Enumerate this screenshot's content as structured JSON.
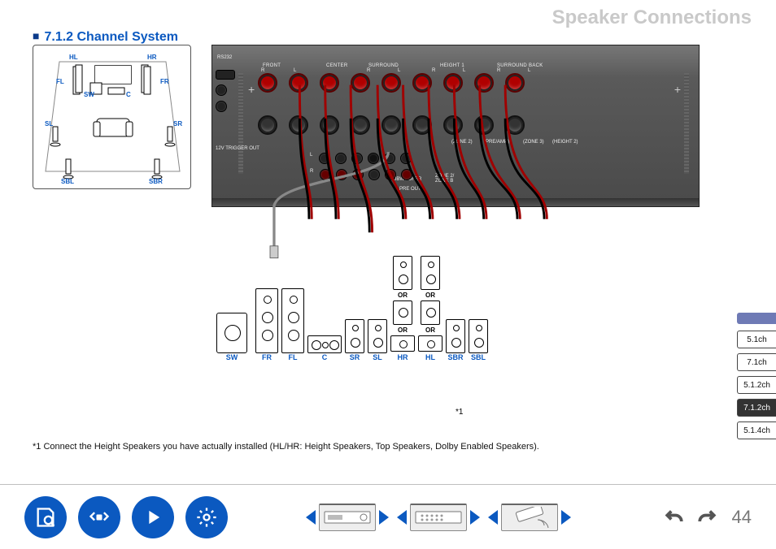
{
  "header": {
    "title": "Speaker Connections"
  },
  "section": {
    "title": "7.1.2 Channel System"
  },
  "room_labels": {
    "hl": "HL",
    "hr": "HR",
    "fl": "FL",
    "fr": "FR",
    "sw": "SW",
    "c": "C",
    "sl": "SL",
    "sr": "SR",
    "sbl": "SBL",
    "sbr": "SBR"
  },
  "panel_groups": [
    "FRONT",
    "CENTER",
    "SURROUND",
    "HEIGHT 1",
    "SURROUND BACK"
  ],
  "panel_rl": {
    "r": "R",
    "l": "L"
  },
  "panel_small_labels": {
    "rs232": "RS232",
    "trigger": "12V TRIGGER OUT",
    "preout": "PRE OUT",
    "subwoofer": "SUBWOOFER",
    "zone2_lineout": "(ZONE 2)",
    "zone3": "(ZONE 3)",
    "preamp": "(PRE/AMP)",
    "height2": "(HEIGHT 2)",
    "zone2_zoneB": "ZONE 2/\nZONE B"
  },
  "speaker_labels": [
    "SW",
    "FR",
    "FL",
    "C",
    "SR",
    "SL",
    "SBR",
    "SBL",
    "HR",
    "HL"
  ],
  "alt_labels": {
    "or": "OR"
  },
  "height_alt": {
    "hr": "HR",
    "hl": "HL"
  },
  "footnote_marker": "*1",
  "footnote_text": "*1 Connect the Height Speakers you have actually installed (HL/HR: Height Speakers, Top Speakers, Dolby Enabled Speakers).",
  "channel_tabs": [
    {
      "label": "5.1ch",
      "active": false
    },
    {
      "label": "7.1ch",
      "active": false
    },
    {
      "label": "5.1.2ch",
      "active": false
    },
    {
      "label": "7.1.2ch",
      "active": true
    },
    {
      "label": "5.1.4ch",
      "active": false
    }
  ],
  "nav_icons": [
    "manual-icon",
    "connections-icon",
    "play-icon",
    "settings-icon"
  ],
  "page_number": "44"
}
